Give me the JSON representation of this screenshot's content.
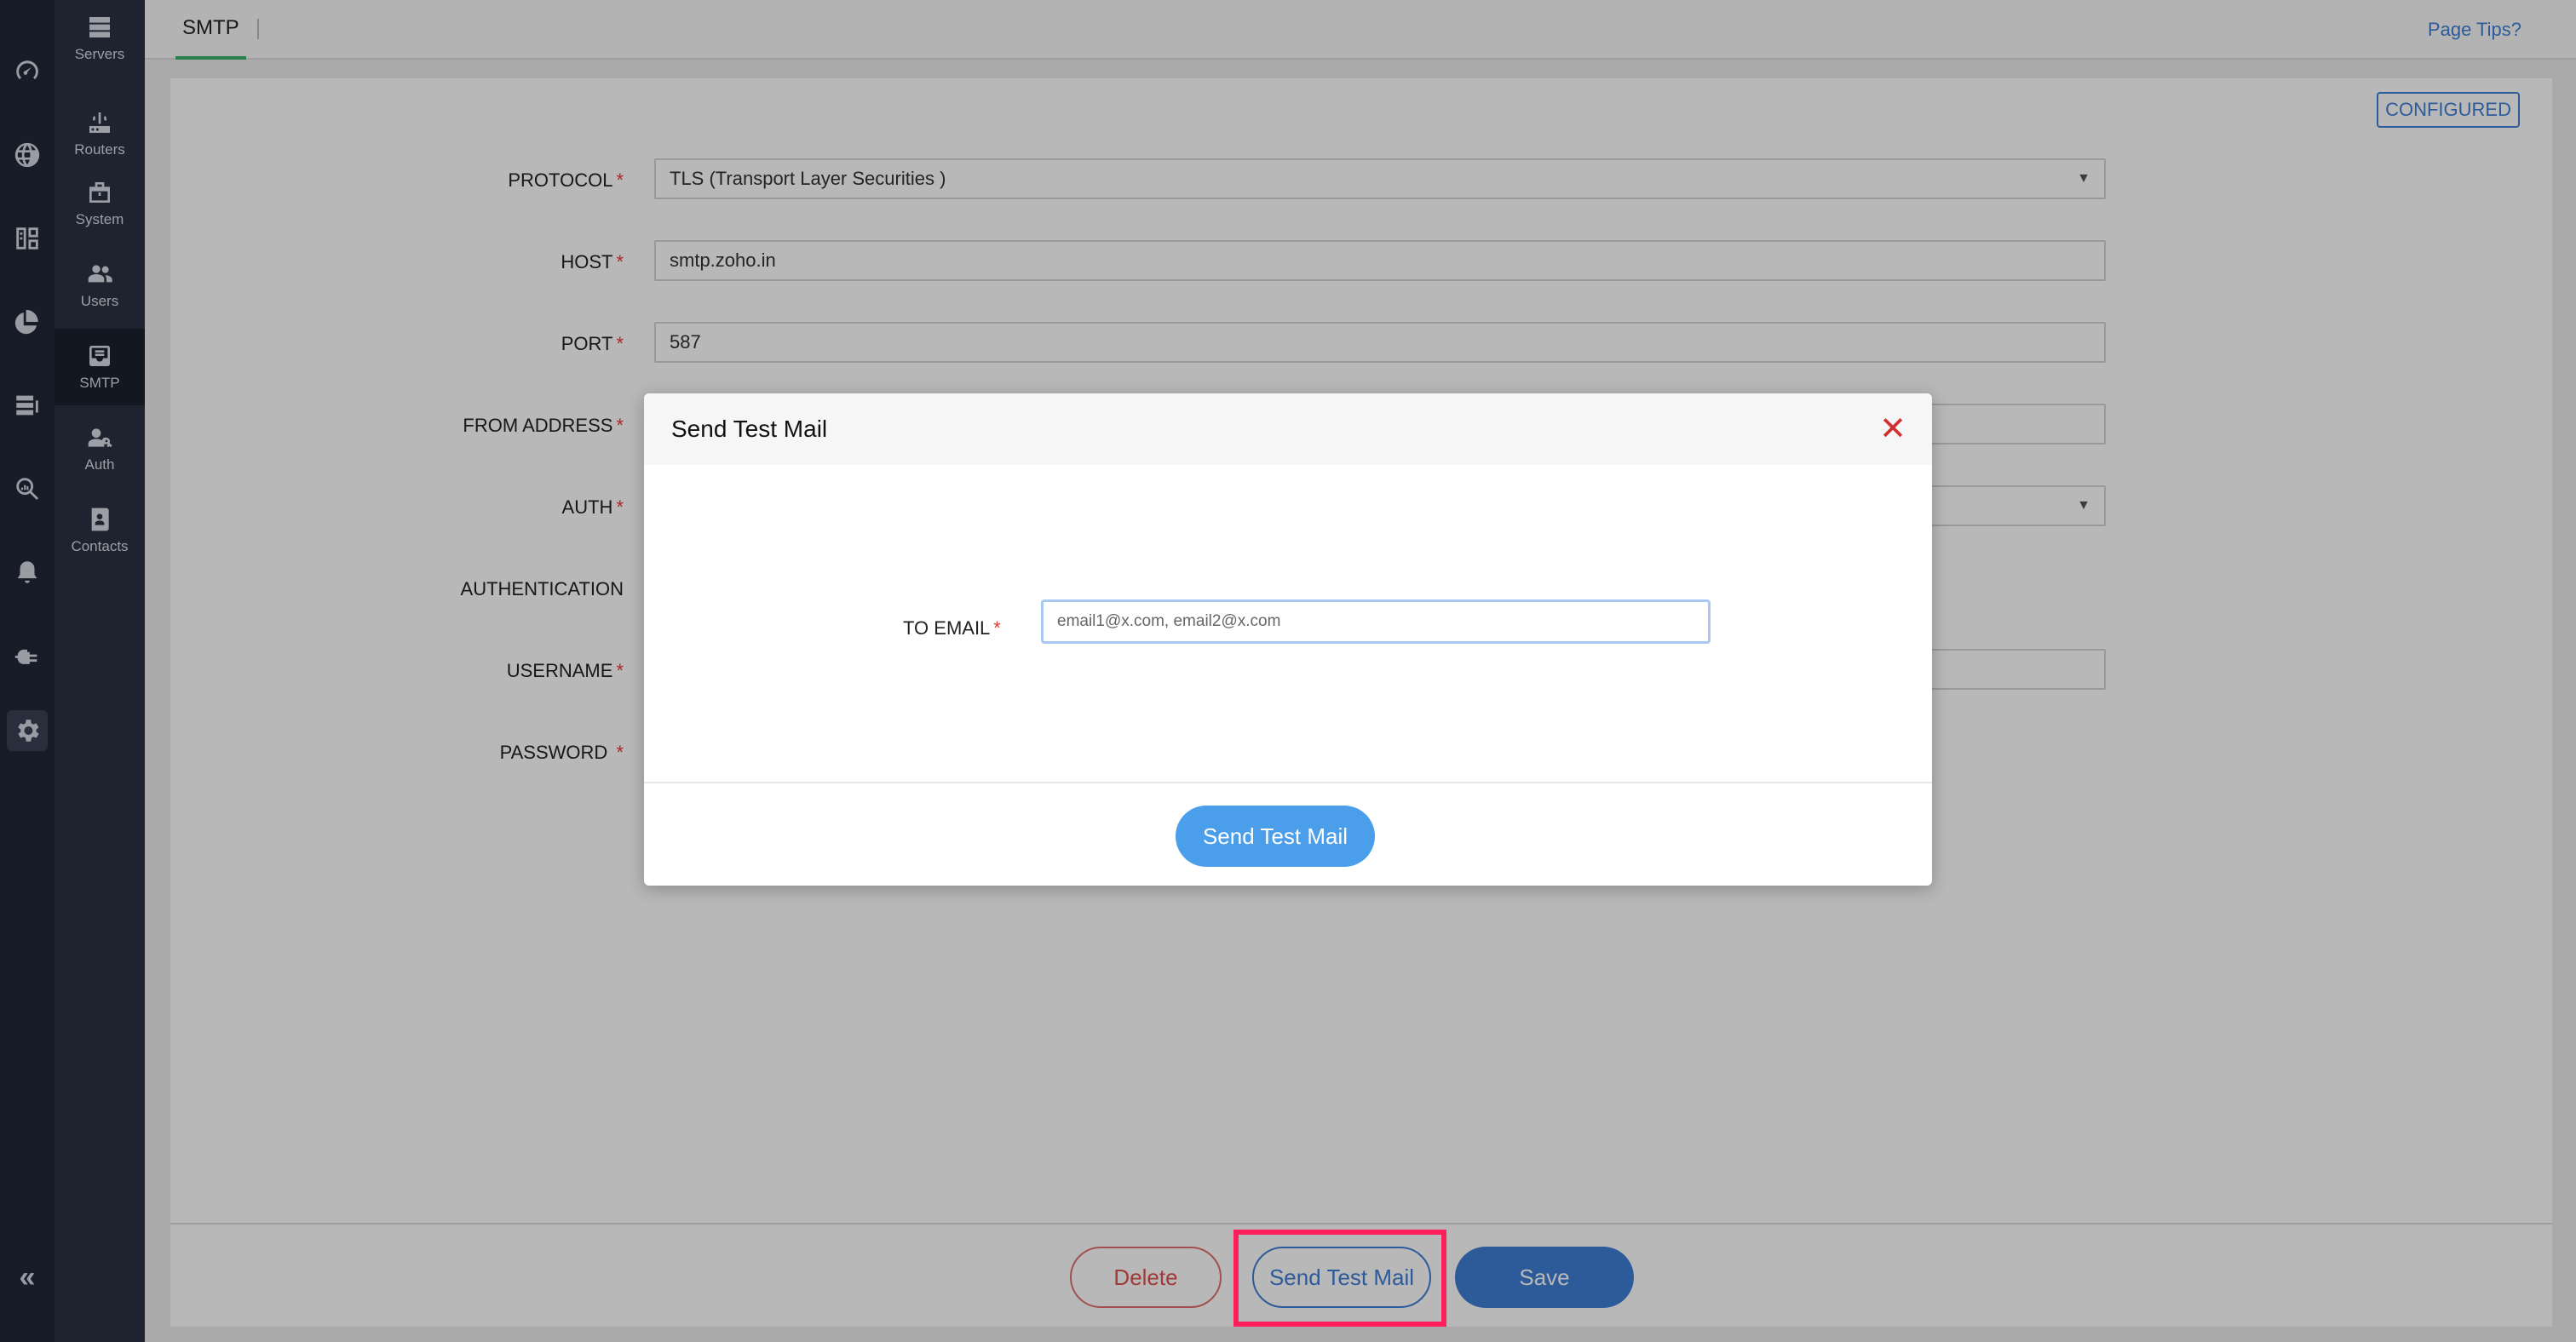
{
  "nav": {
    "rail_icons": [
      "dashboard-icon",
      "dns-globe-icon",
      "inventory-icon",
      "reports-pie-icon",
      "servers-list-icon",
      "search-analytics-icon",
      "notifications-bell-icon",
      "plug-icon",
      "settings-gear-icon"
    ],
    "active_rail_icon": "settings-gear-icon",
    "collapse_label": "«"
  },
  "subnav": {
    "items": [
      {
        "label": "Servers",
        "icon": "servers-icon"
      },
      {
        "label": "Routers",
        "icon": "router-icon"
      },
      {
        "label": "System",
        "icon": "system-icon"
      },
      {
        "label": "Users",
        "icon": "users-icon"
      },
      {
        "label": "SMTP",
        "icon": "smtp-mail-icon"
      },
      {
        "label": "Auth",
        "icon": "auth-user-key-icon"
      },
      {
        "label": "Contacts",
        "icon": "contacts-book-icon"
      }
    ],
    "active": "SMTP"
  },
  "header": {
    "tab": "SMTP",
    "page_tips": "Page Tips?"
  },
  "status_badge": "CONFIGURED",
  "form": {
    "fields": [
      {
        "label": "PROTOCOL",
        "required": true,
        "value": "TLS (Transport Layer Securities )",
        "type": "select"
      },
      {
        "label": "HOST",
        "required": true,
        "value": "smtp.zoho.in",
        "type": "text"
      },
      {
        "label": "PORT",
        "required": true,
        "value": "587",
        "type": "text"
      },
      {
        "label": "FROM ADDRESS",
        "required": true,
        "value": "",
        "type": "text"
      },
      {
        "label": "AUTH",
        "required": true,
        "value": "",
        "type": "select"
      },
      {
        "label": "AUTHENTICATION",
        "required": false,
        "value": "",
        "type": "none"
      },
      {
        "label": "USERNAME",
        "required": true,
        "value": "",
        "type": "text"
      },
      {
        "label": "PASSWORD",
        "required": true,
        "value": "",
        "type": "none"
      }
    ],
    "required_mark": "*"
  },
  "footer": {
    "delete_label": "Delete",
    "send_test_label": "Send Test Mail",
    "save_label": "Save"
  },
  "modal": {
    "title": "Send Test Mail",
    "close_glyph": "✕",
    "to_email_label": "TO EMAIL",
    "to_email_placeholder": "email1@x.com, email2@x.com",
    "to_email_value": "",
    "submit_label": "Send Test Mail"
  },
  "colors": {
    "accent": "#3f7fd6",
    "required": "#e53935",
    "highlight": "#ff1f5a",
    "rail_bg": "#222838",
    "subnav_bg": "#2b3142"
  }
}
